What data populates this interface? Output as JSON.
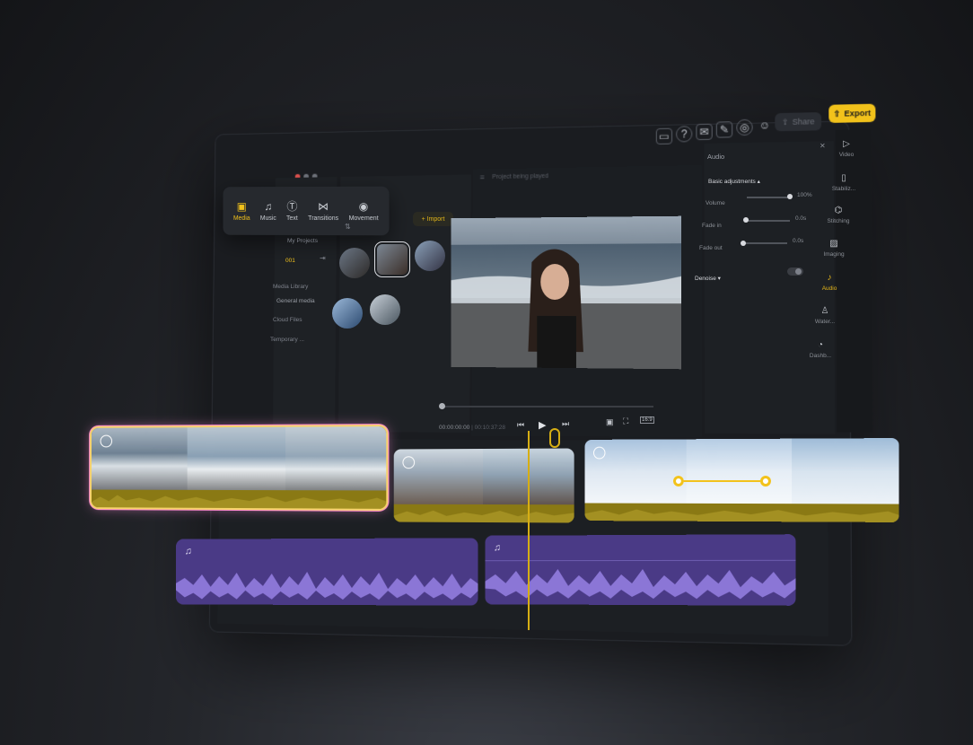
{
  "toolbar": {
    "share_label": "Share",
    "export_label": "Export",
    "icons": [
      "subtitles-icon",
      "help-icon",
      "mail-icon",
      "edit-note-icon",
      "layers-icon",
      "user-icon"
    ]
  },
  "palette": {
    "items": [
      {
        "label": "Media",
        "icon": "folder-icon",
        "active": true
      },
      {
        "label": "Music",
        "icon": "music-icon",
        "active": false
      },
      {
        "label": "Text",
        "icon": "text-icon",
        "active": false
      },
      {
        "label": "Transitions",
        "icon": "transitions-icon",
        "active": false
      },
      {
        "label": "Movement",
        "icon": "movement-icon",
        "active": false
      }
    ]
  },
  "sidebar": {
    "my_projects": "My Projects",
    "project_id": "001",
    "media_library": "Media Library",
    "items": [
      "General media",
      "Cloud Files",
      "Temporary ..."
    ]
  },
  "media": {
    "import_label": "+ Import"
  },
  "preview": {
    "project_title": "Project being played",
    "timecode_current": "00:00:00:00",
    "timecode_total": "00:10:37:28",
    "aspect": "16:9"
  },
  "audio_panel": {
    "title": "Audio",
    "section": "Basic adjustments",
    "volume_label": "Volume",
    "volume_value": "100%",
    "volume_level": 1.0,
    "fade_in_label": "Fade in",
    "fade_in_value": "0.0s",
    "fade_out_label": "Fade out",
    "fade_out_value": "0.0s",
    "denoise_label": "Denoise"
  },
  "rail": {
    "items": [
      {
        "label": "Video",
        "icon": "play-outline-icon",
        "active": false
      },
      {
        "label": "Stabiliz...",
        "icon": "stabilize-icon",
        "active": false
      },
      {
        "label": "Stitching",
        "icon": "stitch-icon",
        "active": false
      },
      {
        "label": "Imaging",
        "icon": "image-icon",
        "active": false
      },
      {
        "label": "Audio",
        "icon": "audio-icon",
        "active": true
      },
      {
        "label": "Water...",
        "icon": "watermark-icon",
        "active": false
      },
      {
        "label": "Dashb...",
        "icon": "dashboard-icon",
        "active": false
      }
    ]
  },
  "colors": {
    "accent": "#f2c21b",
    "audio_clip": "#4a3a86",
    "waveform_video": "#8a7914",
    "waveform_audio": "#8b76d6"
  }
}
